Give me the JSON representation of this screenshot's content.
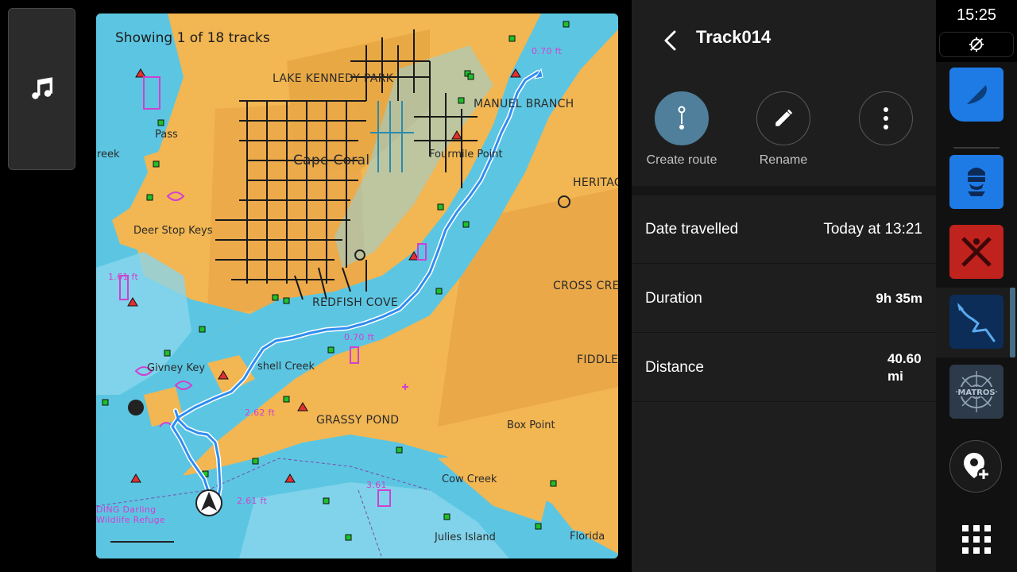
{
  "music_button": {
    "icon": "music-note-icon"
  },
  "map": {
    "track_count_text": "Showing 1 of 18 tracks",
    "labels": {
      "lake_kennedy_park": "LAKE KENNEDY PARK",
      "manuel_branch": "MANUEL BRANCH",
      "cape_coral": "Cape Coral",
      "fourmile_point": "Fourmile Point",
      "heritage": "HERITAG",
      "deer_stop_keys": "Deer Stop Keys",
      "pass": "Pass",
      "creek_left": "reek",
      "redfish_cove": "REDFISH COVE",
      "cross_creek": "CROSS CREE",
      "shell_creek": "shell Creek",
      "givney_key": "Givney Key",
      "fiddle": "FIDDLE",
      "grassy_pond": "GRASSY POND",
      "box_point": "Box Point",
      "cow_creek": "Cow Creek",
      "julies_island": "Julies Island",
      "florida": "Florida",
      "wildlife_refuge_1": "DING Darling",
      "wildlife_refuge_2": "Wildlife Refuge"
    },
    "depths": {
      "d1": "0.70 ft",
      "d2": "1.61 ft",
      "d3": "2.62 ft",
      "d4": "2.61 ft",
      "d5": "3.61",
      "d6": "0.70 ft"
    },
    "colors": {
      "land": "#f2b652",
      "water": "#5cc6e2",
      "track": "#2f8cf0"
    }
  },
  "panel": {
    "title": "Track014",
    "actions": {
      "create_route": "Create route",
      "rename": "Rename"
    },
    "details": {
      "date_label": "Date travelled",
      "date_value": "Today at 13:21",
      "duration_label": "Duration",
      "duration_value": "9h 35m",
      "distance_label": "Distance",
      "distance_value": "40.60 mi"
    }
  },
  "status": {
    "time": "15:25"
  },
  "rail": {
    "apps": [
      "chart-app-icon",
      "diver-app-icon",
      "mob-app-icon",
      "track-app-icon",
      "matros-app-icon"
    ],
    "matros_text": "MATROS"
  }
}
